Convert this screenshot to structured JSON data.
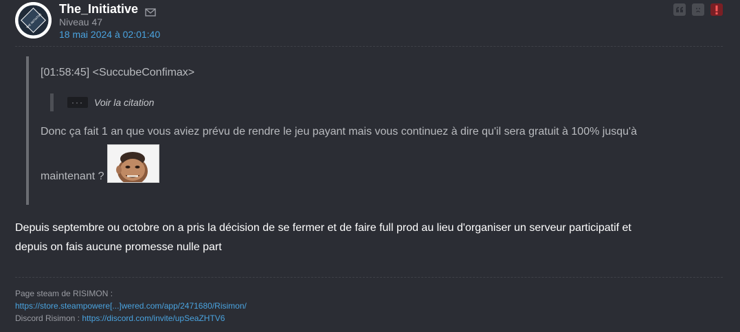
{
  "author": {
    "name": "The_Initiative",
    "level": "Niveau 47",
    "date": "18 mai 2024 à 02:01:40",
    "avatar_text": "THE INITIATIVE"
  },
  "actions": [
    {
      "name": "quote-icon"
    },
    {
      "name": "sad-face-icon"
    },
    {
      "name": "alert-icon"
    }
  ],
  "quote": {
    "header": "[01:58:45] <SuccubeConfimax>",
    "nested_button": "···",
    "nested_link": "Voir la citation",
    "line1": "Donc ça fait 1 an que vous aviez prévu de rendre le jeu payant mais vous continuez à dire qu'il sera gratuit à 100% jusqu'à",
    "line2": "maintenant ?"
  },
  "reply": {
    "line1": "Depuis septembre ou octobre on a pris la décision de se fermer et de faire full prod au lieu d'organiser un serveur participatif et",
    "line2": "depuis on fais aucune promesse nulle part"
  },
  "signature": {
    "steam_label": "Page steam de RISIMON :",
    "steam_link": "https://store.steampowere[...]wered.com/app/2471680/Risimon/",
    "discord_label": "Discord Risimon :",
    "discord_link": "https://discord.com/invite/upSeaZHTV6"
  },
  "colors": {
    "background": "#2b2d34",
    "link": "#4aa3df",
    "alert": "#7a1f24"
  }
}
